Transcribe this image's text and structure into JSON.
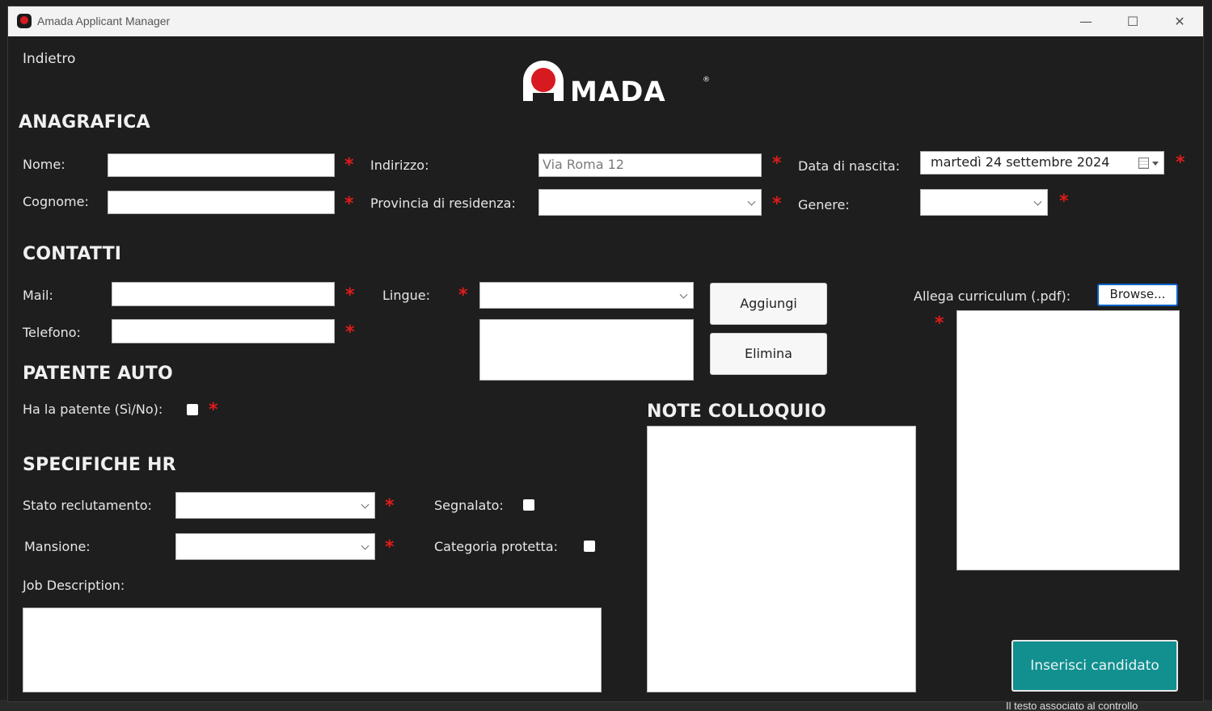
{
  "window": {
    "title": "Amada Applicant Manager",
    "minimize_glyph": "—",
    "maximize_glyph": "☐",
    "close_glyph": "✕"
  },
  "nav": {
    "back_label": "Indietro"
  },
  "logo": {
    "text": "MADA",
    "registered": "®",
    "brand_color": "#d71920"
  },
  "sections": {
    "anagrafica": "ANAGRAFICA",
    "contatti": "CONTATTI",
    "patente": "PATENTE AUTO",
    "specifiche": "SPECIFICHE HR",
    "note": "NOTE COLLOQUIO"
  },
  "anagrafica": {
    "nome_label": "Nome:",
    "nome_value": "",
    "cognome_label": "Cognome:",
    "cognome_value": "",
    "indirizzo_label": "Indirizzo:",
    "indirizzo_placeholder": "Via Roma 12",
    "provincia_label": "Provincia di residenza:",
    "provincia_value": "",
    "nascita_label": "Data di nascita:",
    "nascita_value": "martedì    24 settembre 2024",
    "genere_label": "Genere:",
    "genere_value": ""
  },
  "contatti": {
    "mail_label": "Mail:",
    "mail_value": "",
    "telefono_label": "Telefono:",
    "telefono_value": "",
    "lingue_label": "Lingue:",
    "lingue_value": "",
    "aggiungi_label": "Aggiungi",
    "elimina_label": "Elimina",
    "curriculum_label": "Allega curriculum (.pdf):",
    "browse_label": "Browse..."
  },
  "patente": {
    "label": "Ha la patente (Sì/No):",
    "checked": false
  },
  "hr": {
    "stato_label": "Stato reclutamento:",
    "stato_value": "",
    "mansione_label": "Mansione:",
    "mansione_value": "",
    "segnalato_label": "Segnalato:",
    "categoria_label": "Categoria protetta:",
    "job_label": "Job Description:",
    "job_value": ""
  },
  "required_marker": "*",
  "submit_label": "Inserisci candidato",
  "colors": {
    "background": "#1e1e1e",
    "required": "#e01b1b",
    "submit": "#128f8f",
    "browse_border": "#0a64c8"
  },
  "background_app": {
    "bottom_text": "Il testo associato al controllo"
  }
}
